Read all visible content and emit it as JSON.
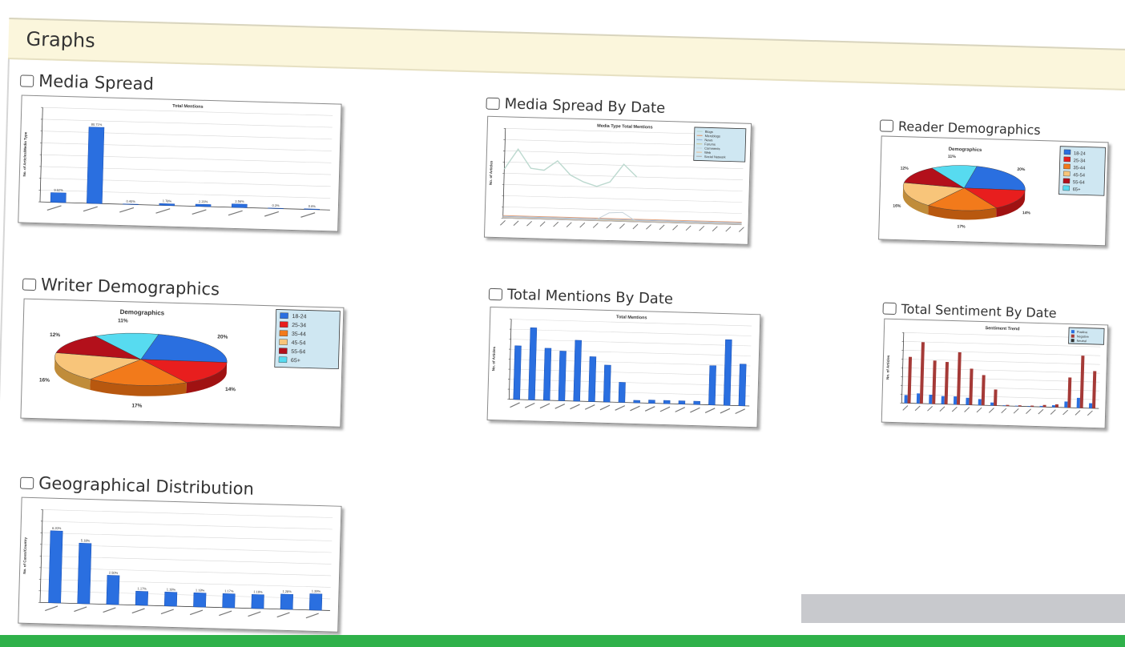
{
  "header": {
    "title": "Graphs"
  },
  "colors": {
    "bar": "#2a6fe0",
    "bar_dark": "#1a4fb0",
    "sentiment_neg": "#a53a37",
    "header_bg": "#fbf6dc",
    "green": "#2fb14a"
  },
  "widgets": [
    {
      "id": "media-spread",
      "title": "Media Spread",
      "chart_data": {
        "type": "bar",
        "title": "Total Mentions",
        "ylabel": "No. of Articles/Media Type",
        "xlabel": "",
        "categories": [
          "",
          "",
          "",
          "",
          "",
          "",
          "",
          ""
        ],
        "values": [
          10.2,
          80.7,
          0.4,
          1.8,
          2.2,
          3.6,
          0.3,
          0.6
        ],
        "data_labels": [
          "9.62%",
          "80.71%",
          "0.40%",
          "1.78%",
          "2.20%",
          "3.56%",
          "0.3%",
          "0.6%"
        ],
        "ylim": [
          0,
          100
        ],
        "grid": true
      }
    },
    {
      "id": "media-spread-by-date",
      "title": "Media Spread By Date",
      "chart_data": {
        "type": "line",
        "title": "Media Type Total Mentions",
        "ylabel": "No. of Articles",
        "xlabel": "",
        "categories": [
          "",
          "",
          "",
          "",
          "",
          "",
          "",
          "",
          "",
          "",
          "",
          "",
          "",
          "",
          "",
          "",
          "",
          "",
          ""
        ],
        "series": [
          {
            "name": "Blogs",
            "values": [
              60,
              85,
              62,
              60,
              72,
              55,
              47,
              42,
              48,
              70,
              55,
              null,
              null,
              null,
              null,
              null,
              null,
              null,
              null
            ]
          },
          {
            "name": "Microblogs",
            "values": [
              3,
              3,
              3,
              3,
              3,
              3,
              3,
              3,
              3,
              3,
              3,
              3,
              3,
              3,
              3,
              3,
              3,
              3,
              3
            ]
          },
          {
            "name": "News",
            "values": [
              2,
              2,
              2,
              2,
              2,
              2,
              2,
              2,
              2,
              2,
              2,
              2,
              2,
              2,
              2,
              2,
              2,
              2,
              2
            ]
          },
          {
            "name": "Forums",
            "values": [
              1,
              1,
              1,
              1,
              1,
              1,
              1,
              1,
              1,
              1,
              1,
              1,
              1,
              1,
              1,
              1,
              1,
              1,
              1
            ]
          },
          {
            "name": "Comments",
            "values": [
              1,
              1,
              1,
              1,
              1,
              1,
              1,
              1,
              10,
              11,
              1,
              1,
              1,
              1,
              1,
              1,
              1,
              1,
              1
            ]
          },
          {
            "name": "Web",
            "values": [
              0.5,
              0.5,
              0.5,
              0.5,
              0.5,
              0.5,
              0.5,
              0.5,
              0.5,
              0.5,
              0.5,
              0.5,
              0.5,
              0.5,
              0.5,
              0.5,
              0.5,
              0.5,
              0.5
            ]
          },
          {
            "name": "Social Network",
            "values": [
              0,
              0,
              0,
              0,
              0,
              0,
              0,
              0,
              0,
              0,
              0,
              0,
              0,
              0,
              0,
              0,
              0,
              0,
              0
            ]
          }
        ],
        "ylim": [
          0,
          110
        ],
        "grid": true,
        "legend": "top-right"
      }
    },
    {
      "id": "reader-demographics",
      "title": "Reader Demographics",
      "chart_data": {
        "type": "pie",
        "title": "Demographics",
        "labels": [
          "18-24",
          "25-34",
          "35-44",
          "45-54",
          "55-64",
          "65+"
        ],
        "values": [
          20,
          14,
          17,
          16,
          12,
          11
        ],
        "data_labels": [
          "20%",
          "14%",
          "17%",
          "16%",
          "12%",
          "11%"
        ],
        "legend": "right"
      }
    },
    {
      "id": "writer-demographics",
      "title": "Writer Demographics",
      "chart_data": {
        "type": "pie",
        "title": "Demographics",
        "labels": [
          "18-24",
          "25-34",
          "35-44",
          "45-54",
          "55-64",
          "65+"
        ],
        "values": [
          20,
          14,
          17,
          16,
          12,
          11
        ],
        "data_labels": [
          "20%",
          "14%",
          "17%",
          "16%",
          "12%",
          "11%"
        ],
        "legend": "right"
      }
    },
    {
      "id": "total-mentions-by-date",
      "title": "Total Mentions By Date",
      "chart_data": {
        "type": "bar",
        "title": "Total Mentions",
        "ylabel": "No. of Articles",
        "xlabel": "",
        "categories": [
          "",
          "",
          "",
          "",
          "",
          "",
          "",
          "",
          "",
          "",
          "",
          "",
          "",
          "",
          "",
          "",
          "",
          ""
        ],
        "values": [
          6.7,
          9.0,
          6.5,
          6.2,
          7.6,
          5.6,
          4.6,
          2.5,
          0.3,
          0.4,
          0.4,
          0.4,
          0.4,
          4.9,
          8.2,
          5.2
        ],
        "ylim": [
          0,
          10
        ],
        "grid": true
      }
    },
    {
      "id": "total-sentiment-by-date",
      "title": "Total Sentiment By Date",
      "chart_data": {
        "type": "bar",
        "title": "Sentiment Trend",
        "ylabel": "No. of Articles",
        "xlabel": "",
        "categories": [
          "",
          "",
          "",
          "",
          "",
          "",
          "",
          "",
          "",
          "",
          "",
          "",
          "",
          "",
          "",
          "",
          "",
          ""
        ],
        "series": [
          {
            "name": "Positive",
            "values": [
              8,
              10,
              9,
              8,
              8,
              7,
              6,
              3,
              0.5,
              0.5,
              0.5,
              1,
              2,
              6,
              10,
              5
            ]
          },
          {
            "name": "Negative",
            "values": [
              46,
              61,
              43,
              42,
              52,
              36,
              30,
              16,
              1,
              1,
              1,
              2,
              3,
              30,
              52,
              37
            ]
          },
          {
            "name": "Neutral",
            "values": [
              0,
              0,
              0,
              0,
              0,
              0,
              0,
              0,
              0,
              0,
              0,
              0,
              0,
              0,
              0,
              0
            ]
          }
        ],
        "ylim": [
          0,
          70
        ],
        "grid": true,
        "legend": "top-right"
      }
    },
    {
      "id": "geographical-distribution",
      "title": "Geographical Distribution",
      "chart_data": {
        "type": "bar",
        "title": "",
        "ylabel": "No. of Cases/Country",
        "xlabel": "",
        "categories": [
          "",
          "",
          "",
          "",
          "",
          "",
          "",
          "",
          "",
          ""
        ],
        "values": [
          6.2,
          5.2,
          2.5,
          1.2,
          1.2,
          1.2,
          1.2,
          1.2,
          1.3,
          1.4
        ],
        "data_labels": [
          "6.20%",
          "5.18%",
          "2.50%",
          "1.17%",
          "1.18%",
          "1.18%",
          "1.17%",
          "1.19%",
          "1.28%",
          "1.39%"
        ],
        "ylim": [
          0,
          8
        ],
        "grid": true
      }
    }
  ]
}
